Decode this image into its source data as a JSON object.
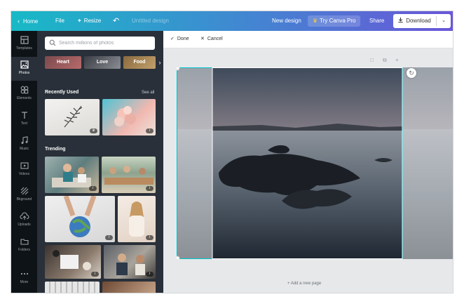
{
  "topbar": {
    "home": "Home",
    "file": "File",
    "resize": "Resize",
    "title_placeholder": "Untitled design",
    "new_design": "New design",
    "try_pro": "Try Canva Pro",
    "share": "Share",
    "download": "Download"
  },
  "sidebar": {
    "items": [
      {
        "label": "Templates",
        "icon": "templates-icon"
      },
      {
        "label": "Photos",
        "icon": "photos-icon"
      },
      {
        "label": "Elements",
        "icon": "elements-icon"
      },
      {
        "label": "Text",
        "icon": "text-icon"
      },
      {
        "label": "Music",
        "icon": "music-icon"
      },
      {
        "label": "Videos",
        "icon": "videos-icon"
      },
      {
        "label": "Bkground",
        "icon": "background-icon"
      },
      {
        "label": "Uploads",
        "icon": "uploads-icon"
      },
      {
        "label": "Folders",
        "icon": "folders-icon"
      },
      {
        "label": "More",
        "icon": "more-icon"
      }
    ],
    "active": "Photos"
  },
  "panel": {
    "search_placeholder": "Search millions of photos",
    "chips": [
      "Heart",
      "Love",
      "Food"
    ],
    "recently_used": "Recently Used",
    "see_all": "See all",
    "trending": "Trending"
  },
  "toolbar": {
    "done": "Done",
    "cancel": "Cancel"
  },
  "canvas": {
    "add_page": "+ Add a new page"
  },
  "colors": {
    "gradient_start": "#18b9c6",
    "gradient_end": "#6a56d8",
    "sidebar_bg": "#0e1318",
    "panel_bg": "#293039",
    "selection": "#00c4cc"
  }
}
